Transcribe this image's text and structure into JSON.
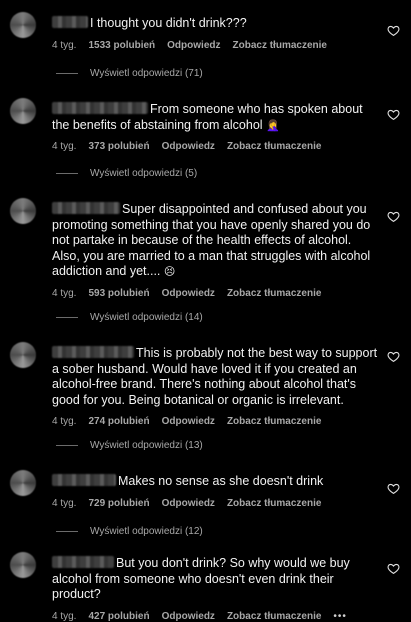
{
  "comments": [
    {
      "text": "I thought you didn't drink???",
      "age": "4 tyg.",
      "likes": "1533 polubień",
      "reply": "Odpowiedz",
      "translate": "Zobacz tłumaczenie",
      "view_replies": "Wyświetl odpowiedzi (71)",
      "emoji": ""
    },
    {
      "text": "From someone who has spoken about the benefits of abstaining from alcohol",
      "age": "4 tyg.",
      "likes": "373 polubień",
      "reply": "Odpowiedz",
      "translate": "Zobacz tłumaczenie",
      "view_replies": "Wyświetl odpowiedzi (5)",
      "emoji": "🤦‍♀️"
    },
    {
      "text": "Super disappointed and confused about you promoting something that you have openly shared you do not partake in because of the health effects of alcohol. Also, you are married to a man that struggles with alcohol addiction and yet....",
      "age": "4 tyg.",
      "likes": "593 polubień",
      "reply": "Odpowiedz",
      "translate": "Zobacz tłumaczenie",
      "view_replies": "Wyświetl odpowiedzi (14)",
      "emoji": "😣"
    },
    {
      "text": "This is probably not the best way to support a sober husband. Would have loved it if you created an alcohol-free brand. There's nothing about alcohol that's good for you. Being botanical or organic is irrelevant.",
      "age": "4 tyg.",
      "likes": "274 polubień",
      "reply": "Odpowiedz",
      "translate": "Zobacz tłumaczenie",
      "view_replies": "Wyświetl odpowiedzi (13)",
      "emoji": ""
    },
    {
      "text": "Makes no sense as she doesn't drink",
      "age": "4 tyg.",
      "likes": "729 polubień",
      "reply": "Odpowiedz",
      "translate": "Zobacz tłumaczenie",
      "view_replies": "Wyświetl odpowiedzi (12)",
      "emoji": ""
    },
    {
      "text": "But you don't drink? So why would we buy alcohol from someone who doesn't even drink their product?",
      "age": "4 tyg.",
      "likes": "427 polubień",
      "reply": "Odpowiedz",
      "translate": "Zobacz tłumaczenie",
      "more": "•••",
      "emoji": ""
    }
  ],
  "icons": {
    "like": "heart-outline-icon",
    "options": "more-options-icon"
  },
  "colors": {
    "background": "#000000",
    "text": "#f2f2f2",
    "muted": "#a8a8a8"
  }
}
